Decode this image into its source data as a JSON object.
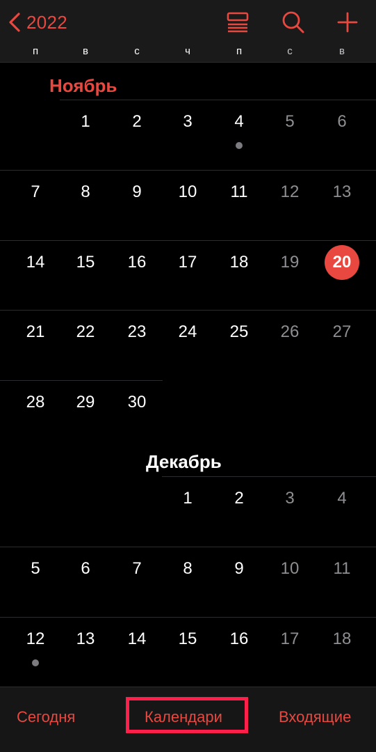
{
  "nav": {
    "back_label": "2022",
    "icons": [
      "chevron-left-icon",
      "list-view-icon",
      "search-icon",
      "plus-icon"
    ]
  },
  "weekdays": [
    "п",
    "в",
    "с",
    "ч",
    "п",
    "с",
    "в"
  ],
  "months": [
    {
      "name": "Ноябрь",
      "is_current": true,
      "weeks": [
        [
          null,
          1,
          2,
          3,
          4,
          5,
          6
        ],
        [
          7,
          8,
          9,
          10,
          11,
          12,
          13
        ],
        [
          14,
          15,
          16,
          17,
          18,
          19,
          20
        ],
        [
          21,
          22,
          23,
          24,
          25,
          26,
          27
        ],
        [
          28,
          29,
          30,
          null,
          null,
          null,
          null
        ]
      ],
      "event_days": [
        4
      ],
      "today": 20
    },
    {
      "name": "Декабрь",
      "is_current": false,
      "weeks": [
        [
          null,
          null,
          null,
          1,
          2,
          3,
          4
        ],
        [
          5,
          6,
          7,
          8,
          9,
          10,
          11
        ],
        [
          12,
          13,
          14,
          15,
          16,
          17,
          18
        ]
      ],
      "event_days": [
        12
      ],
      "today": null
    }
  ],
  "tabs": {
    "today": "Сегодня",
    "calendars": "Календари",
    "inbox": "Входящие"
  },
  "colors": {
    "accent": "#e8483f",
    "highlight_box": "#ff1f4b",
    "weekend_text": "#8e8e93",
    "event_dot": "#7c7c80"
  }
}
